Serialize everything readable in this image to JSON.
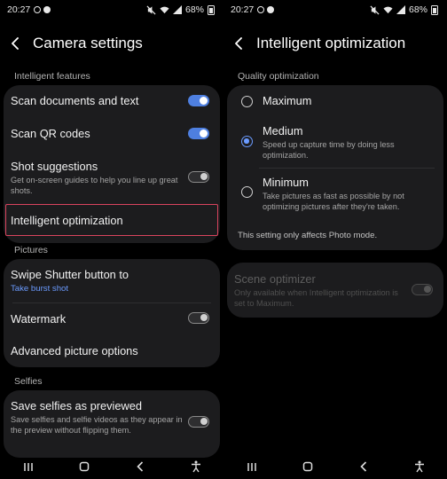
{
  "left_screen": {
    "status": {
      "time": "20:27",
      "battery": "68%"
    },
    "header": {
      "title": "Camera settings"
    },
    "sections": {
      "intelligent_features": "Intelligent features",
      "pictures": "Pictures",
      "selfies": "Selfies"
    },
    "intelligent_items": [
      {
        "label": "Scan documents and text",
        "toggle": "on"
      },
      {
        "label": "Scan QR codes",
        "toggle": "on"
      },
      {
        "label": "Shot suggestions",
        "description": "Get on-screen guides to help you line up great shots.",
        "toggle": "off"
      },
      {
        "label": "Intelligent optimization",
        "highlighted": true
      }
    ],
    "picture_items": [
      {
        "label": "Swipe Shutter button to",
        "value": "Take burst shot"
      },
      {
        "label": "Watermark",
        "toggle": "off"
      },
      {
        "label": "Advanced picture options"
      }
    ],
    "selfie_items": [
      {
        "label": "Save selfies as previewed",
        "description": "Save selfies and selfie videos as they appear in the preview without flipping them.",
        "toggle": "off"
      }
    ]
  },
  "right_screen": {
    "status": {
      "time": "20:27",
      "battery": "68%"
    },
    "header": {
      "title": "Intelligent optimization"
    },
    "section": "Quality optimization",
    "options": [
      {
        "label": "Maximum",
        "selected": false
      },
      {
        "label": "Medium",
        "description": "Speed up capture time by doing less optimization.",
        "selected": true
      },
      {
        "label": "Minimum",
        "description": "Take pictures as fast as possible by not optimizing pictures after they're taken.",
        "selected": false
      }
    ],
    "note": "This setting only affects Photo mode.",
    "scene_optimizer": {
      "label": "Scene optimizer",
      "description": "Only available when Intelligent optimization is set to Maximum.",
      "toggle": "disabled"
    }
  },
  "colors": {
    "accent": "#6b9bff",
    "toggle_on": "#4e7fe0",
    "highlight_border": "#d9445e",
    "card": "#1c1c1e"
  }
}
